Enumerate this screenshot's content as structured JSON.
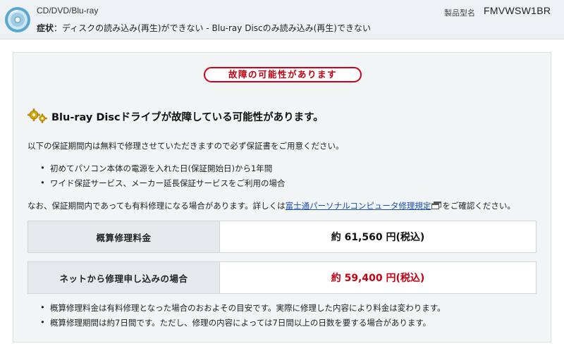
{
  "header": {
    "category": "CD/DVD/Blu-ray",
    "symptom_label": "症状",
    "symptom_text": "：ディスクの読み込み(再生)ができない - Blu-ray Discのみ読み込み(再生)できない",
    "model_label": "製品型名",
    "model_value": "FMVWSW1BR"
  },
  "panel": {
    "status_pill": "故障の可能性があります",
    "heading": "Blu-ray Discドライブが故障している可能性があります。",
    "intro": "以下の保証期間内は無料で修理させていただきますので必ず保証書をご用意ください。",
    "warranty_items": [
      "初めてパソコン本体の電源を入れた日(保証開始日)から1年間",
      "ワイド保証サービス、メーカー延長保証サービスをご利用の場合"
    ],
    "note_prefix": "なお、保証期間内であっても有料修理になる場合があります。詳しくは",
    "note_link": "富士通パーソナルコンピュータ修理規定",
    "note_suffix": "をご確認ください。",
    "prices": [
      {
        "label": "概算修理料金",
        "value": "約 61,560 円(税込)"
      },
      {
        "label": "ネットから修理申し込みの場合",
        "value": "約 59,400 円(税込)"
      }
    ],
    "footnotes": [
      "概算修理料金は有料修理となった場合のおおよその目安です。実際に修理した内容により料金は変わります。",
      "概算修理期間は約7日間です。ただし、修理の内容によっては7日間以上の日数を要する場合があります。"
    ]
  },
  "colors": {
    "accent_red": "#c40012",
    "link_blue": "#1a4eb0",
    "header_bg": "#eef1f3",
    "panel_bg": "#f2f5f6"
  }
}
